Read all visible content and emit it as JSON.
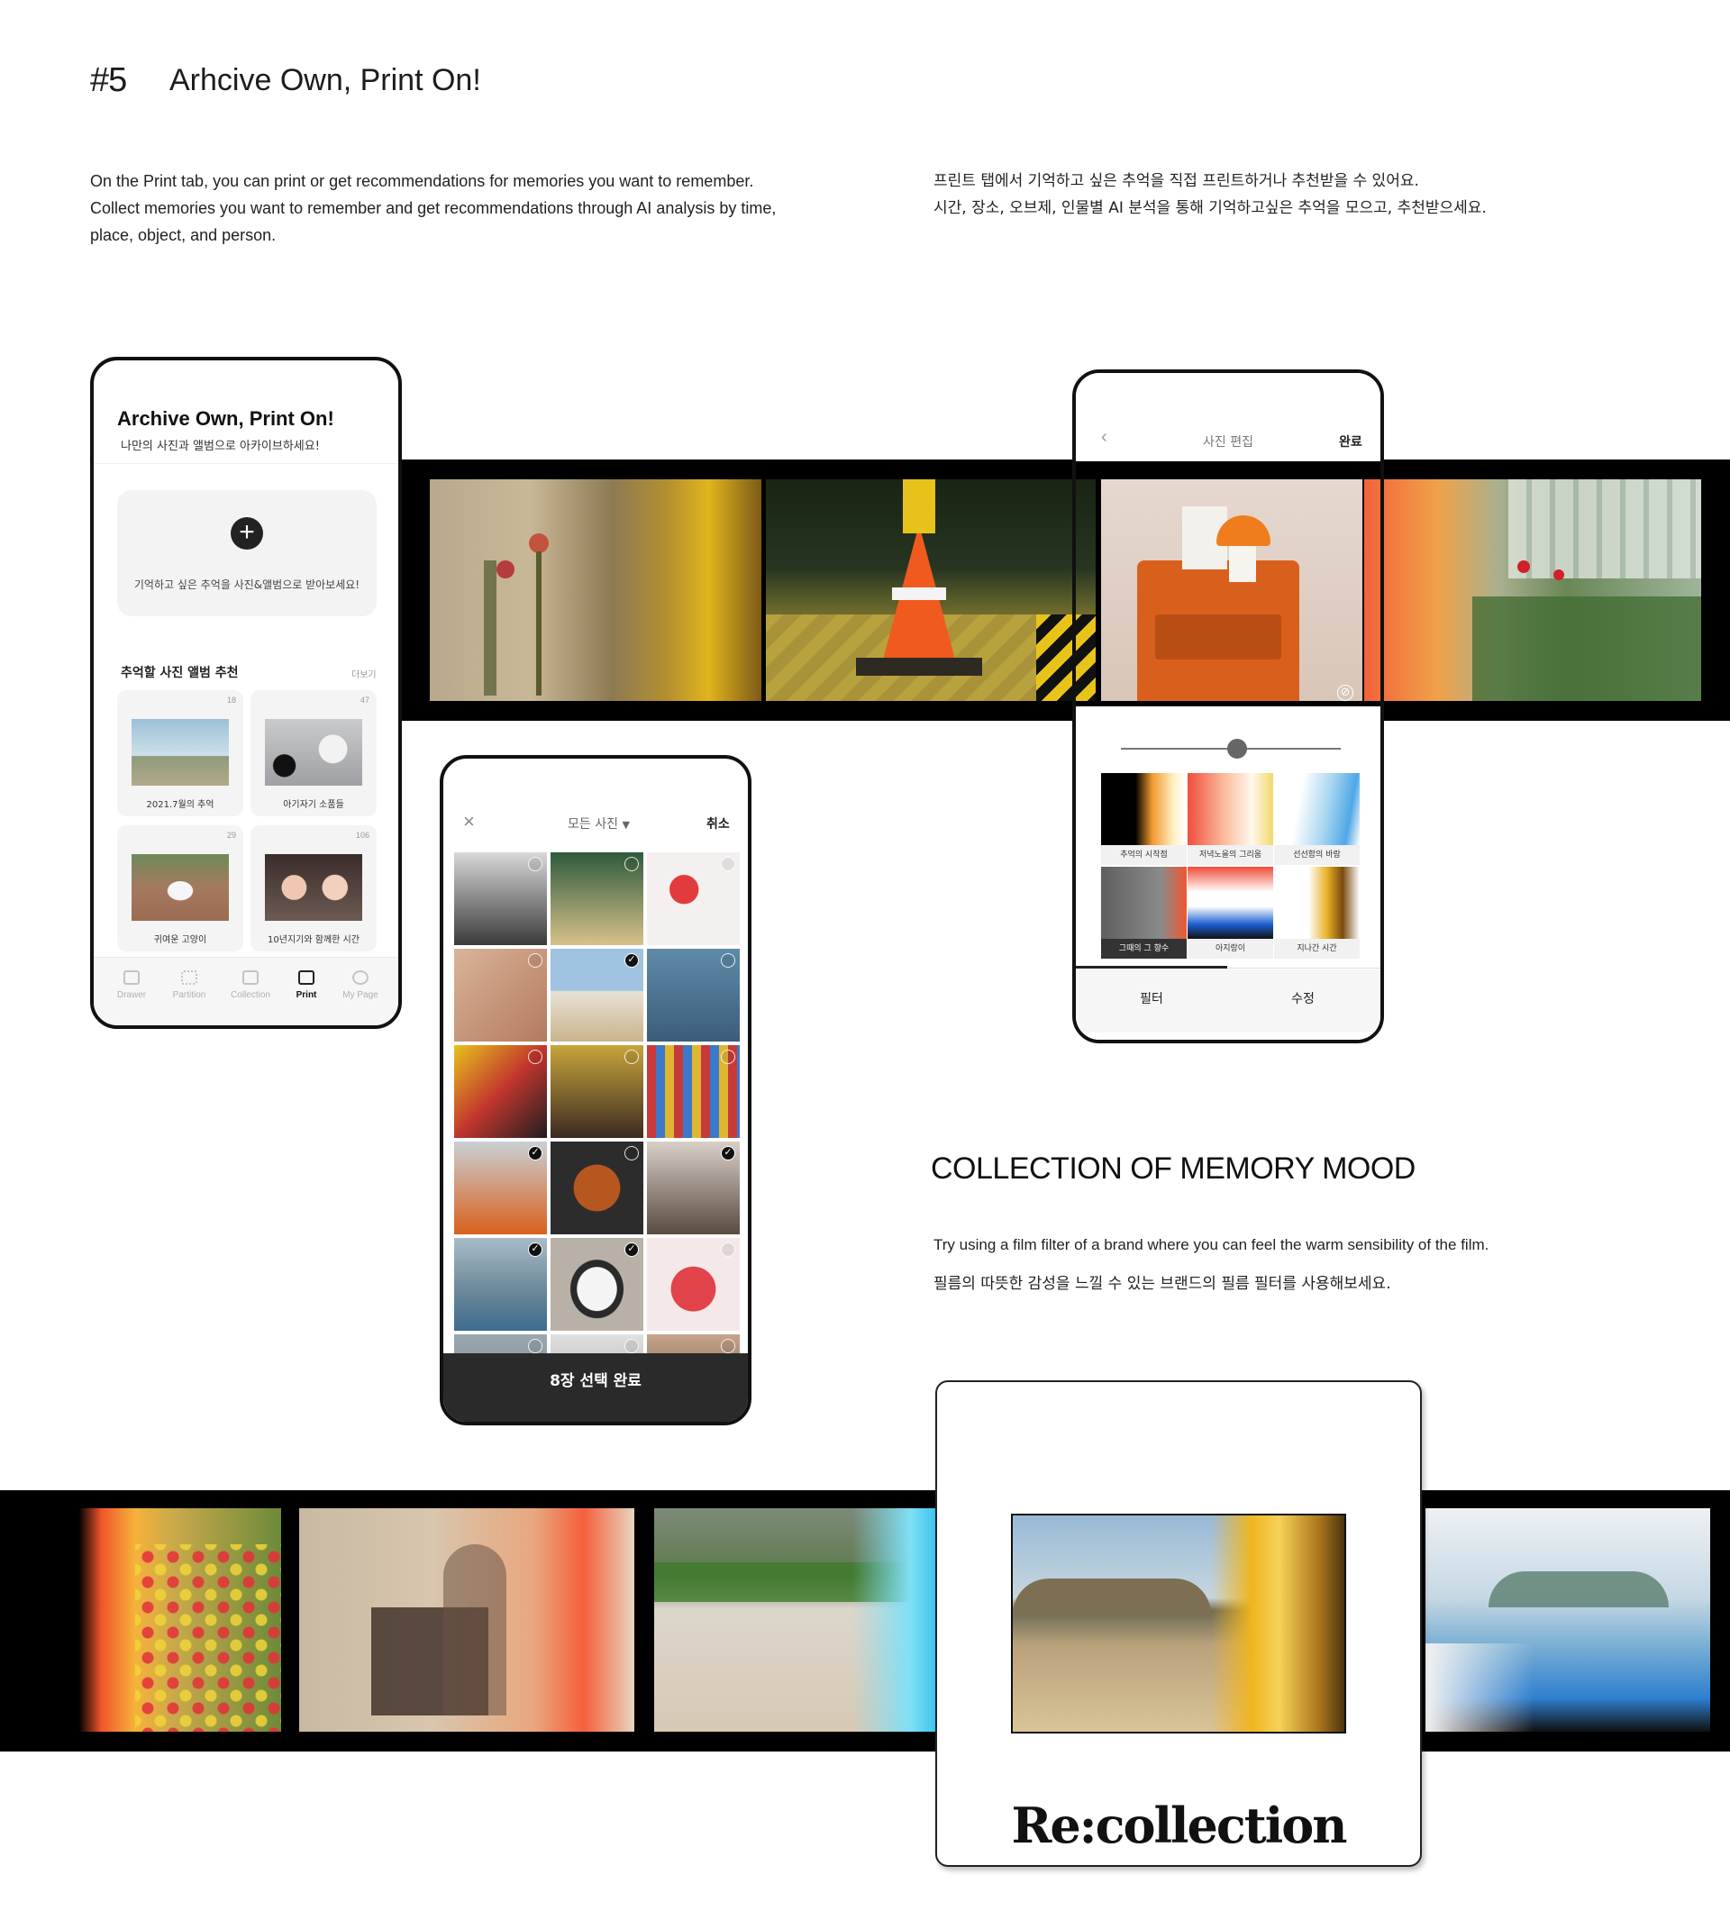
{
  "header": {
    "number": "#5",
    "title": "Arhcive Own, Print On!"
  },
  "intro": {
    "en": "On the Print tab, you can print or get recommendations for memories you want to remember. Collect memories you want to remember and get recommendations through AI analysis by time, place, object, and person.",
    "ko_line1": "프린트 탭에서 기억하고 싶은 추억을 직접 프린트하거나 추천받을 수 있어요.",
    "ko_line2": "시간, 장소, 오브제, 인물별 AI 분석을 통해 기억하고싶은 추억을 모으고, 추천받으세요."
  },
  "phone_print": {
    "title": "Archive Own, Print On!",
    "subtitle": "나만의 사진과 앨범으로 아카이브하세요!",
    "add_icon": "plus-icon",
    "add_text": "기억하고 싶은 추억을 사진&앨범으로 받아보세요!",
    "rec_title": "추억할 사진 앨범 추천",
    "rec_more": "더보기",
    "albums": [
      {
        "count": "18",
        "name": "2021.7월의 추억"
      },
      {
        "count": "47",
        "name": "아기자기 소품들"
      },
      {
        "count": "29",
        "name": "귀여운 고양이"
      },
      {
        "count": "106",
        "name": "10년지기와 함께한 시간"
      }
    ],
    "tabs": [
      {
        "label": "Drawer",
        "icon": "drawer-icon"
      },
      {
        "label": "Partition",
        "icon": "partition-icon"
      },
      {
        "label": "Collection",
        "icon": "collection-icon"
      },
      {
        "label": "Print",
        "icon": "print-icon"
      },
      {
        "label": "My Page",
        "icon": "profile-icon"
      }
    ]
  },
  "phone_select": {
    "close_icon": "close-icon",
    "dropdown": "모든 사진",
    "cancel": "취소",
    "confirm": "8장 선택  완료",
    "checked": [
      false,
      false,
      false,
      false,
      true,
      false,
      false,
      false,
      false,
      true,
      false,
      true,
      true,
      true,
      false,
      false,
      false,
      false
    ]
  },
  "phone_edit": {
    "back_icon": "chevron-left-icon",
    "title": "사진 편집",
    "done": "완료",
    "slider_value": 0.53,
    "filters": [
      {
        "name": "추억의 시작점"
      },
      {
        "name": "저녁노을의 그리움"
      },
      {
        "name": "선선함의 바람"
      },
      {
        "name": "그때의 그 향수"
      },
      {
        "name": "아지랑이"
      },
      {
        "name": "지나간 시간"
      }
    ],
    "tab_filter": "필터",
    "tab_edit": "수정",
    "no_icon": "no-symbol-icon"
  },
  "mood": {
    "title": "COLLECTION OF MEMORY MOOD",
    "en": "Try using a film filter of a brand where you can feel the warm sensibility of the film.",
    "ko": "필름의 따뜻한 감성을 느낄 수 있는 브랜드의 필름 필터를 사용해보세요."
  },
  "brand": {
    "logo": "Re:collection"
  },
  "colors": {
    "film_black": "#000000",
    "accent_dark": "#2a2a2a"
  }
}
